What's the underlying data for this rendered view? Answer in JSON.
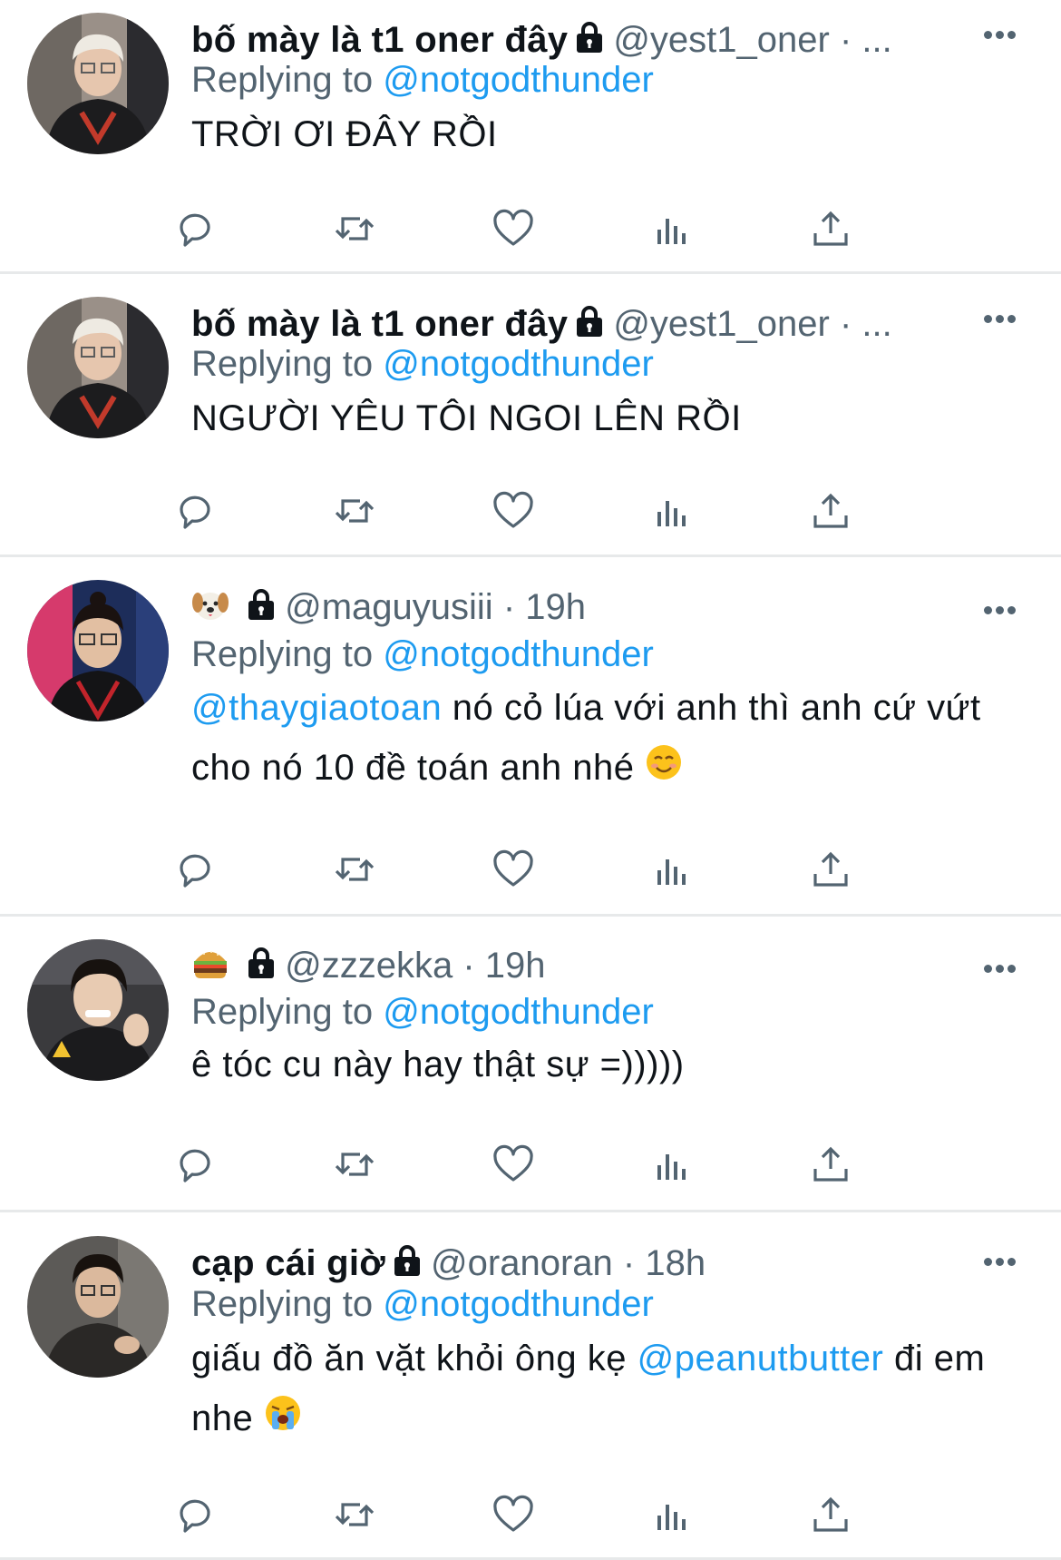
{
  "colors": {
    "accent": "#1d9bf0",
    "text": "#0f1419",
    "muted": "#536471",
    "divider": "#e7e9ea"
  },
  "tweets": [
    {
      "display_name": "bố mày là t1 oner đây",
      "display_emoji": "",
      "handle": "@yest1_oner",
      "meta": "· ...",
      "replying_label": "Replying to",
      "replying_to": "@notgodthunder",
      "text_before": "TRỜI ƠI ĐÂY RỒI",
      "mention": "",
      "text_after": "",
      "trailing_emoji": "",
      "avatar_icon": "user-avatar-icon"
    },
    {
      "display_name": "bố mày là t1 oner đây",
      "display_emoji": "",
      "handle": "@yest1_oner",
      "meta": "· ...",
      "replying_label": "Replying to",
      "replying_to": "@notgodthunder",
      "text_before": "NGƯỜI YÊU TÔI NGOI LÊN RỒI",
      "mention": "",
      "text_after": "",
      "trailing_emoji": "",
      "avatar_icon": "user-avatar-icon"
    },
    {
      "display_name": "",
      "display_emoji": "dog-face-emoji",
      "handle": "@maguyusiii",
      "meta": "· 19h",
      "replying_label": "Replying to",
      "replying_to": "@notgodthunder",
      "text_before": "",
      "mention": "@thaygiaotoan",
      "text_after": " nó cỏ lúa với anh thì anh cứ vứt cho nó 10 đề toán anh nhé",
      "trailing_emoji": "smiling-face-emoji",
      "avatar_icon": "user-avatar-icon"
    },
    {
      "display_name": "",
      "display_emoji": "hamburger-emoji",
      "handle": "@zzzekka",
      "meta": "· 19h",
      "replying_label": "Replying to",
      "replying_to": "@notgodthunder",
      "text_before": "ê tóc cu này hay thật sự =)))))",
      "mention": "",
      "text_after": "",
      "trailing_emoji": "",
      "avatar_icon": "user-avatar-icon"
    },
    {
      "display_name": "cạp cái giờ",
      "display_emoji": "",
      "handle": "@oranoran",
      "meta": "· 18h",
      "replying_label": "Replying to",
      "replying_to": "@notgodthunder",
      "text_before": "giấu đồ ăn vặt khỏi ông kẹ ",
      "mention": "@peanutbutter",
      "text_after": " đi em nhe",
      "trailing_emoji": "loudly-crying-face-emoji",
      "avatar_icon": "user-avatar-icon"
    }
  ],
  "actions": [
    "reply-icon",
    "retweet-icon",
    "like-icon",
    "views-icon",
    "share-icon"
  ]
}
